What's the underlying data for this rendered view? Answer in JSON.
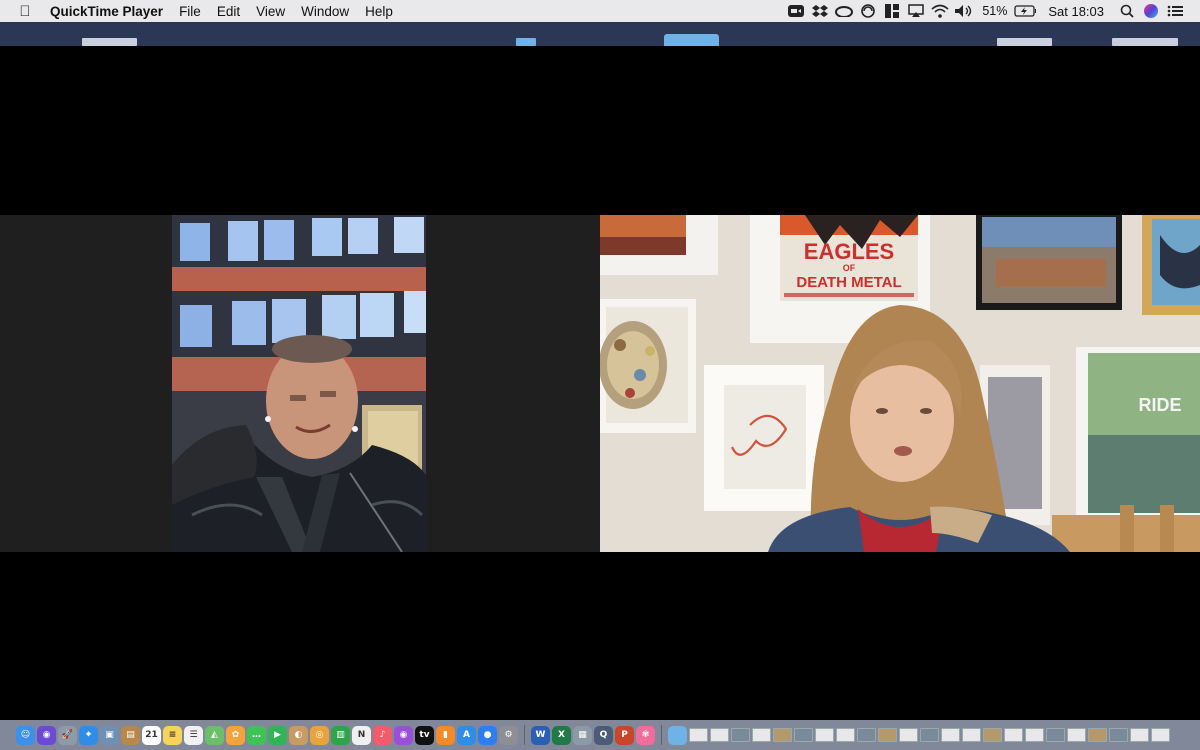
{
  "menubar": {
    "app_name": "QuickTime Player",
    "menus": [
      "File",
      "Edit",
      "View",
      "Window",
      "Help"
    ],
    "battery_percent": "51%",
    "clock": "Sat 18:03"
  },
  "video_call": {
    "left_participant_scene": "man-outdoors",
    "right_participant_scene": "child-indoors",
    "poster_text_line1": "EAGLES",
    "poster_text_line2": "DEATH METAL",
    "poster_text_of": "OF",
    "poster_right_text": "RIDE"
  },
  "dock": {
    "calendar_date": "21",
    "icons": [
      {
        "name": "finder-icon",
        "color": "#3d8fe8",
        "glyph": "☺"
      },
      {
        "name": "siri-icon",
        "color": "#6b4bd6",
        "glyph": "◉"
      },
      {
        "name": "launchpad-icon",
        "color": "#8f9aa8",
        "glyph": "🚀"
      },
      {
        "name": "safari-icon",
        "color": "#2f8de8",
        "glyph": "⌖"
      },
      {
        "name": "preview-icon",
        "color": "#6e8fb6",
        "glyph": "▣"
      },
      {
        "name": "notes-brown-icon",
        "color": "#b8874a",
        "glyph": "▤"
      },
      {
        "name": "calendar-icon",
        "color": "#ffffff",
        "glyph": "21"
      },
      {
        "name": "notes-icon",
        "color": "#f6d35a",
        "glyph": "≡"
      },
      {
        "name": "reminders-icon",
        "color": "#f1f1f1",
        "glyph": "☰"
      },
      {
        "name": "maps-icon",
        "color": "#6cbf6a",
        "glyph": "◭"
      },
      {
        "name": "photos-icon",
        "color": "#f6a23c",
        "glyph": "✿"
      },
      {
        "name": "messages-icon",
        "color": "#3ec356",
        "glyph": "…"
      },
      {
        "name": "facetime-icon",
        "color": "#32b457",
        "glyph": "▶"
      },
      {
        "name": "contacts-icon",
        "color": "#c99a62",
        "glyph": "◐"
      },
      {
        "name": "chrome-icon",
        "color": "#e8a33d",
        "glyph": "◎"
      },
      {
        "name": "numbers-icon",
        "color": "#2fa54a",
        "glyph": "▥"
      },
      {
        "name": "news-icon",
        "color": "#f0f0f0",
        "glyph": "N"
      },
      {
        "name": "music-icon",
        "color": "#f35b6b",
        "glyph": "♪"
      },
      {
        "name": "podcasts-icon",
        "color": "#9a4fd8",
        "glyph": "◉"
      },
      {
        "name": "appletv-icon",
        "color": "#111111",
        "glyph": "tv"
      },
      {
        "name": "books-icon",
        "color": "#f28a2a",
        "glyph": "▮"
      },
      {
        "name": "appstore-icon",
        "color": "#2f8de8",
        "glyph": "A"
      },
      {
        "name": "zoom-icon",
        "color": "#2d7ff0",
        "glyph": "●"
      },
      {
        "name": "settings-icon",
        "color": "#8d8f94",
        "glyph": "⚙"
      }
    ],
    "icons_after_sep": [
      {
        "name": "word-icon",
        "color": "#2b5fb5",
        "glyph": "W"
      },
      {
        "name": "excel-icon",
        "color": "#1f7a45",
        "glyph": "X"
      },
      {
        "name": "image-capture-icon",
        "color": "#8c9aa7",
        "glyph": "▦"
      },
      {
        "name": "quicktime-icon",
        "color": "#4b5b78",
        "glyph": "Q"
      },
      {
        "name": "powerpoint-icon",
        "color": "#c9462a",
        "glyph": "P"
      },
      {
        "name": "flower-app-icon",
        "color": "#ee6d9b",
        "glyph": "✾"
      }
    ]
  }
}
